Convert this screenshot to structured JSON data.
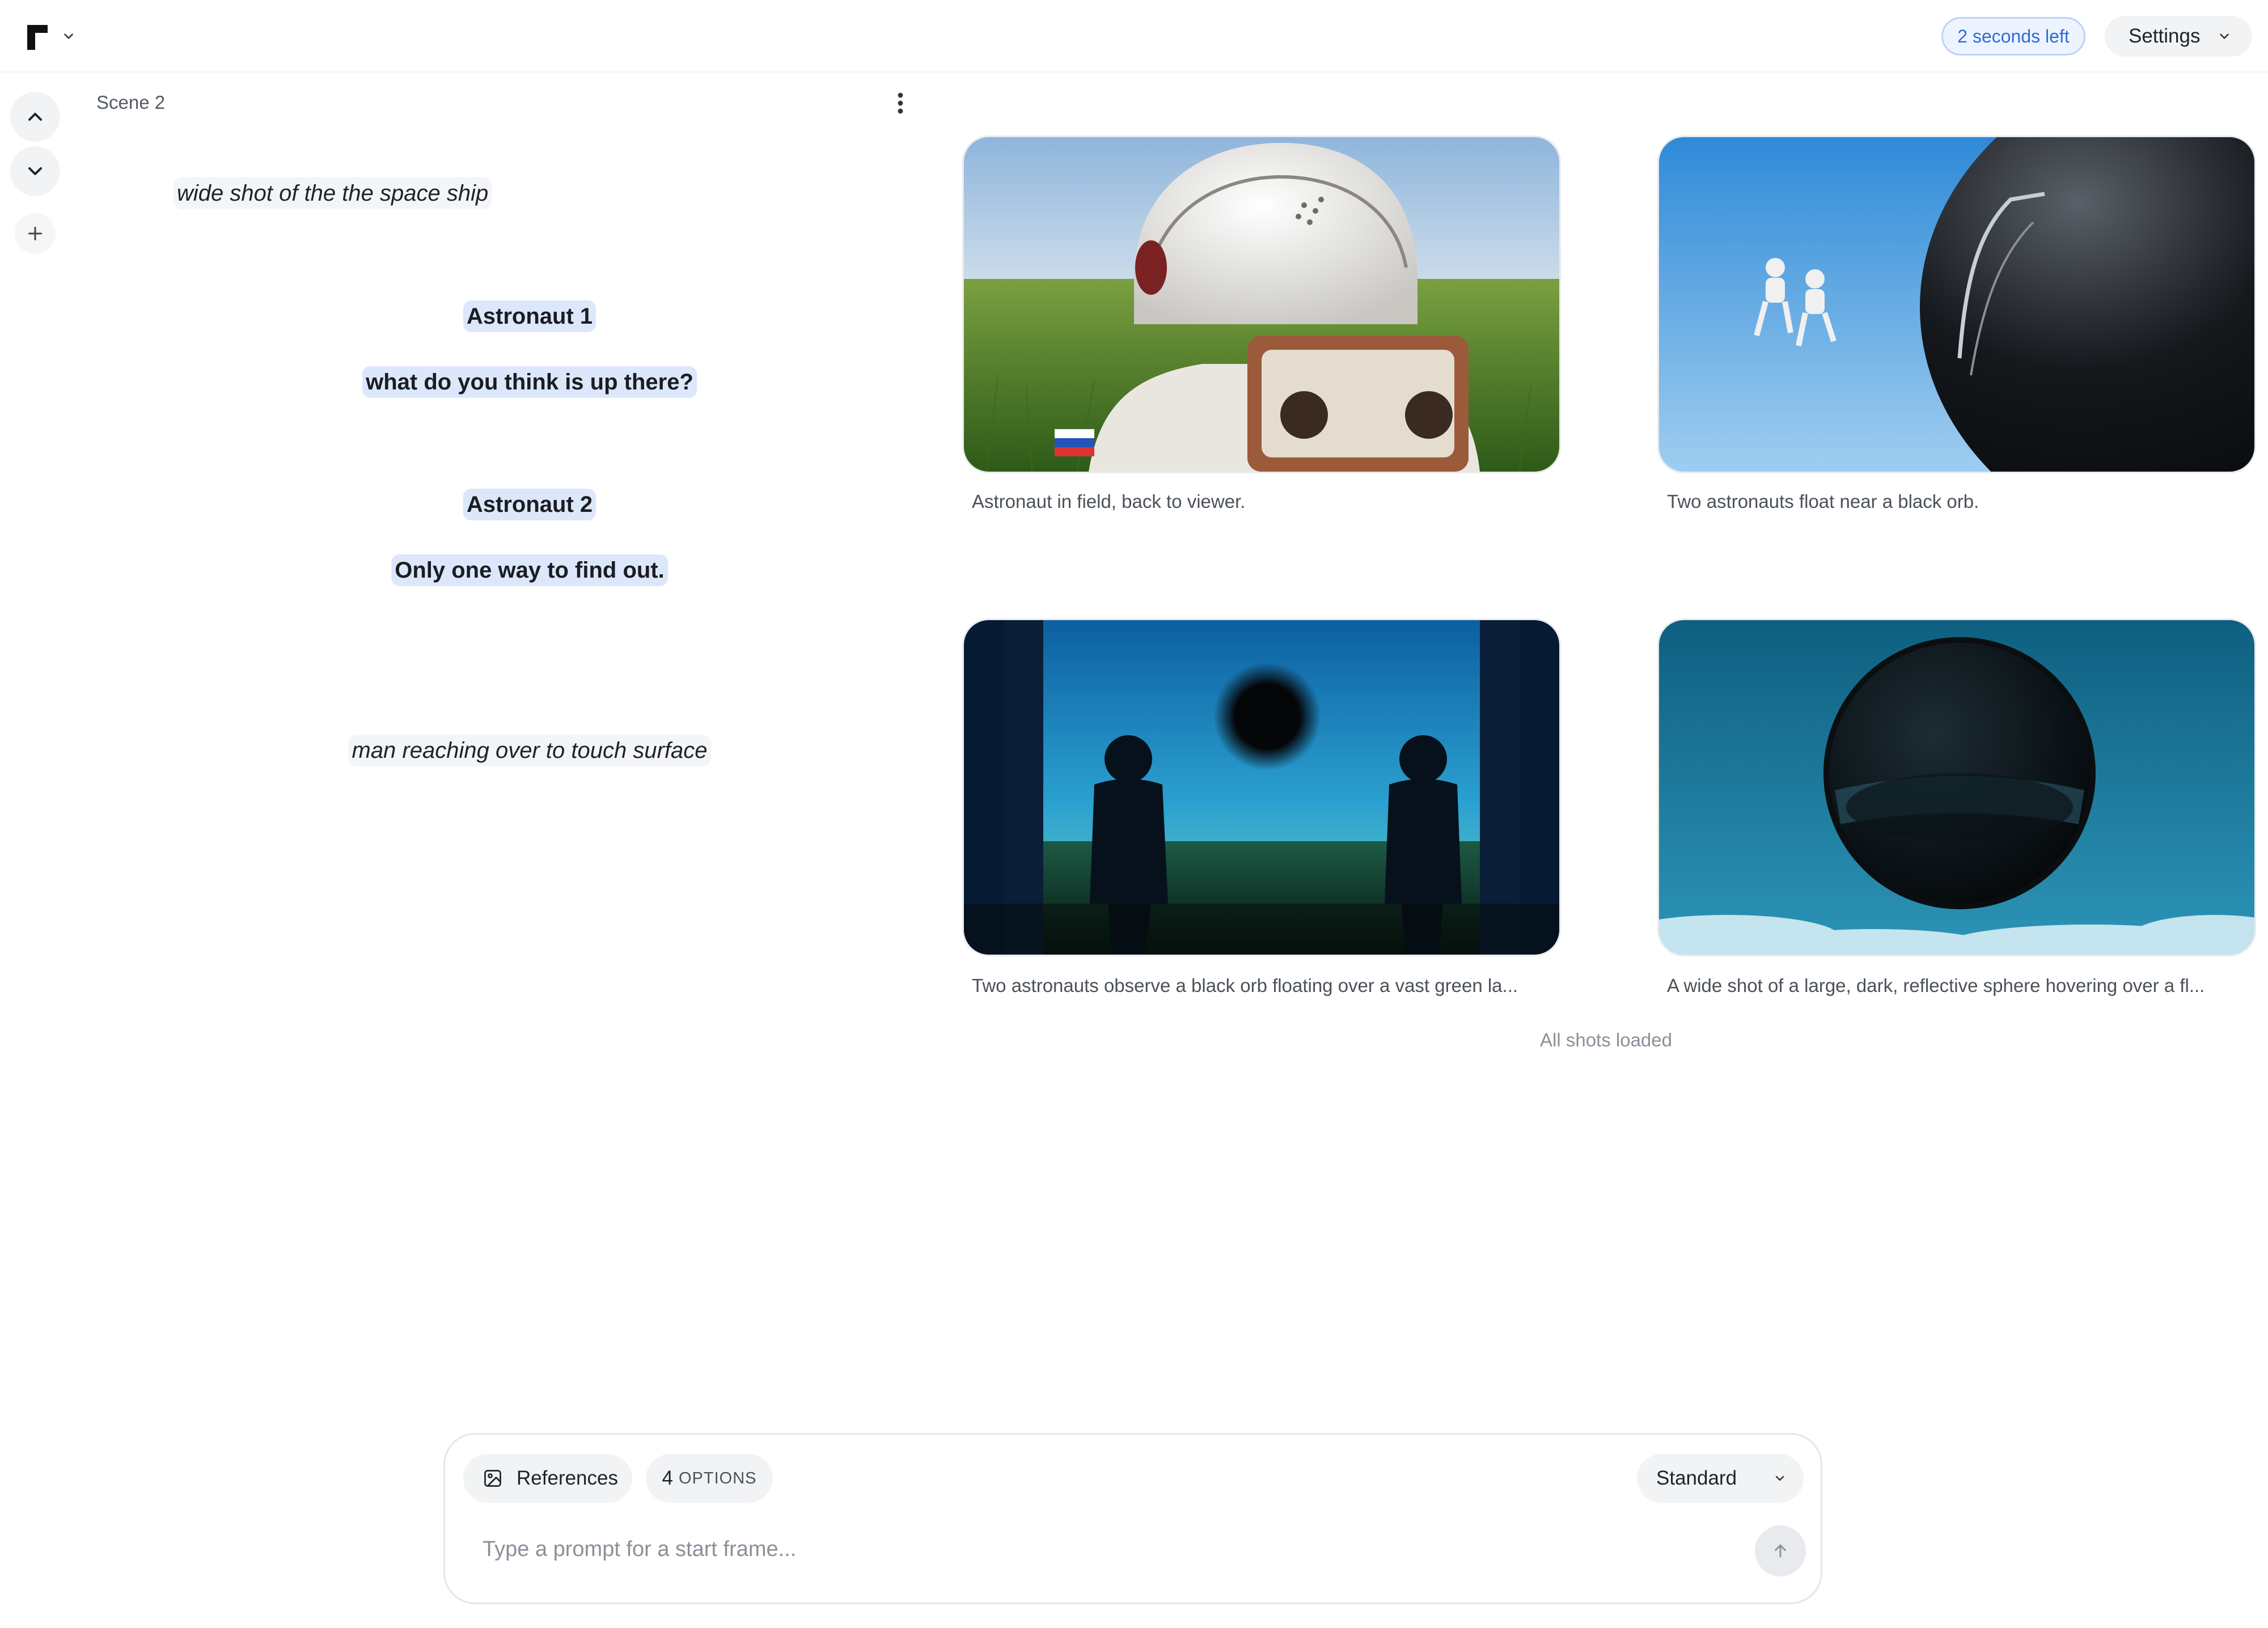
{
  "header": {
    "credits_text": "2 seconds left",
    "settings_label": "Settings"
  },
  "scene": {
    "title": "Scene 2",
    "script": {
      "action_1": "wide shot of the the space ship",
      "character_1": "Astronaut 1",
      "dialogue_1": "what do you think is up there?",
      "character_2": "Astronaut 2",
      "dialogue_2": "Only one way to find out.",
      "action_2": "man reaching over to touch surface"
    }
  },
  "shots": [
    {
      "caption": "Astronaut in field, back to viewer."
    },
    {
      "caption": "Two astronauts float near a black orb."
    },
    {
      "caption": "Two astronauts observe a black orb floating over a vast green la..."
    },
    {
      "caption": "A wide shot of a large, dark, reflective sphere hovering over a fl..."
    }
  ],
  "shots_status": "All shots loaded",
  "composer": {
    "references_label": "References",
    "options_count": "4",
    "options_label": "OPTIONS",
    "mode_label": "Standard",
    "prompt_value": "",
    "prompt_placeholder": "Type a prompt for a start frame..."
  },
  "icons": {
    "logo": "app-logo",
    "logo_menu": "chevron-down-icon",
    "settings": "chevron-down-icon",
    "prev_scene": "chevron-up-icon",
    "next_scene": "chevron-down-icon",
    "add_scene": "plus-icon",
    "scene_menu": "more-vertical-icon",
    "references": "image-icon",
    "mode": "chevron-down-icon",
    "send": "arrow-up-icon"
  },
  "colors": {
    "accent": "#2f6bd8",
    "highlight": "#dce7fb",
    "chip": "#f2f3f5"
  }
}
